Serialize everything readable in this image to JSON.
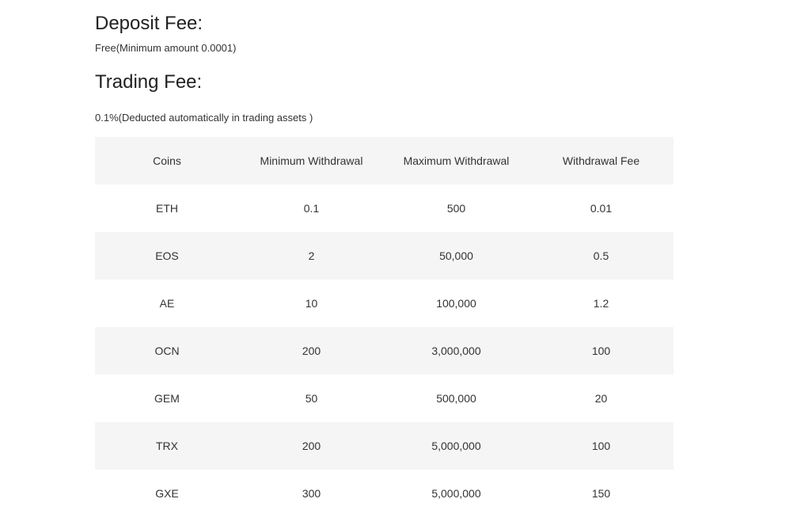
{
  "deposit": {
    "title": "Deposit Fee:",
    "text": "Free(Minimum amount 0.0001)"
  },
  "trading": {
    "title": "Trading Fee:",
    "text": "0.1%(Deducted automatically in trading assets )"
  },
  "table": {
    "headers": [
      "Coins",
      "Minimum Withdrawal",
      "Maximum Withdrawal",
      "Withdrawal Fee"
    ],
    "rows": [
      [
        "ETH",
        "0.1",
        "500",
        "0.01"
      ],
      [
        "EOS",
        "2",
        "50,000",
        "0.5"
      ],
      [
        "AE",
        "10",
        "100,000",
        "1.2"
      ],
      [
        "OCN",
        "200",
        "3,000,000",
        "100"
      ],
      [
        "GEM",
        "50",
        "500,000",
        "20"
      ],
      [
        "TRX",
        "200",
        "5,000,000",
        "100"
      ],
      [
        "GXE",
        "300",
        "5,000,000",
        "150"
      ]
    ]
  }
}
